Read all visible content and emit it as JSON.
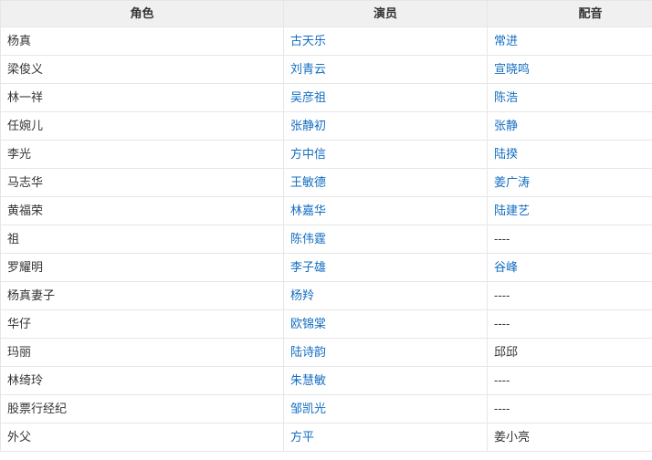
{
  "colors": {
    "link_blue": "#136ec2",
    "text": "#333333",
    "header_bg": "#f0f0f0",
    "border": "#e6e6e6"
  },
  "table": {
    "headers": [
      "角色",
      "演员",
      "配音"
    ],
    "rows": [
      {
        "role": "杨真",
        "actor": "古天乐",
        "voice": "常进",
        "voice_is_link": true
      },
      {
        "role": "梁俊义",
        "actor": "刘青云",
        "voice": "宣晓鸣",
        "voice_is_link": true
      },
      {
        "role": "林一祥",
        "actor": "吴彦祖",
        "voice": "陈浩",
        "voice_is_link": true
      },
      {
        "role": "任婉儿",
        "actor": "张静初",
        "voice": "张静",
        "voice_is_link": true
      },
      {
        "role": "李光",
        "actor": "方中信",
        "voice": "陆揆",
        "voice_is_link": true
      },
      {
        "role": "马志华",
        "actor": "王敏德",
        "voice": "姜广涛",
        "voice_is_link": true
      },
      {
        "role": "黄福荣",
        "actor": "林嘉华",
        "voice": "陆建艺",
        "voice_is_link": true
      },
      {
        "role": "祖",
        "actor": "陈伟霆",
        "voice": "----",
        "voice_is_link": false
      },
      {
        "role": "罗耀明",
        "actor": "李子雄",
        "voice": "谷峰",
        "voice_is_link": true
      },
      {
        "role": "杨真妻子",
        "actor": "杨羚",
        "voice": "----",
        "voice_is_link": false
      },
      {
        "role": "华仔",
        "actor": "欧锦棠",
        "voice": "----",
        "voice_is_link": false
      },
      {
        "role": "玛丽",
        "actor": "陆诗韵",
        "voice": "邱邱",
        "voice_is_link": false
      },
      {
        "role": "林绮玲",
        "actor": "朱慧敏",
        "voice": "----",
        "voice_is_link": false
      },
      {
        "role": "股票行经纪",
        "actor": "邹凯光",
        "voice": "----",
        "voice_is_link": false
      },
      {
        "role": "外父",
        "actor": "方平",
        "voice": "姜小亮",
        "voice_is_link": false
      }
    ]
  }
}
